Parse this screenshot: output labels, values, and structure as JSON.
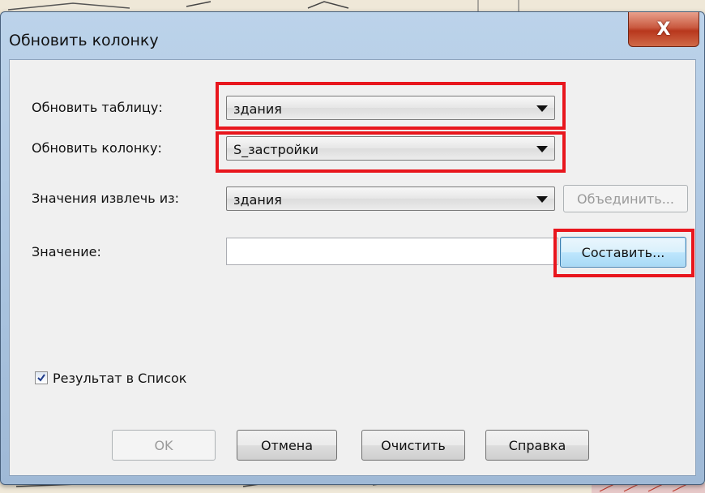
{
  "dialog": {
    "title": "Обновить колонку",
    "close_symbol": "X"
  },
  "fields": {
    "update_table": {
      "label": "Обновить таблицу:",
      "value": "здания"
    },
    "update_column": {
      "label": "Обновить колонку:",
      "value": "S_застройки"
    },
    "values_from": {
      "label": "Значения извлечь из:",
      "value": "здания"
    },
    "value": {
      "label": "Значение:",
      "value": ""
    }
  },
  "buttons": {
    "join": "Объединить...",
    "compose": "Составить...",
    "ok": "OK",
    "cancel": "Отмена",
    "clear": "Очистить",
    "help": "Справка"
  },
  "checkbox": {
    "label": "Результат в Список",
    "checked": true
  },
  "colors": {
    "highlight": "#e8161d",
    "window_frame": "#a9c3df",
    "close_button": "#c95a41"
  },
  "icons": {
    "close": "close-icon",
    "dropdown": "chevron-down-icon",
    "check": "checkmark-icon"
  }
}
